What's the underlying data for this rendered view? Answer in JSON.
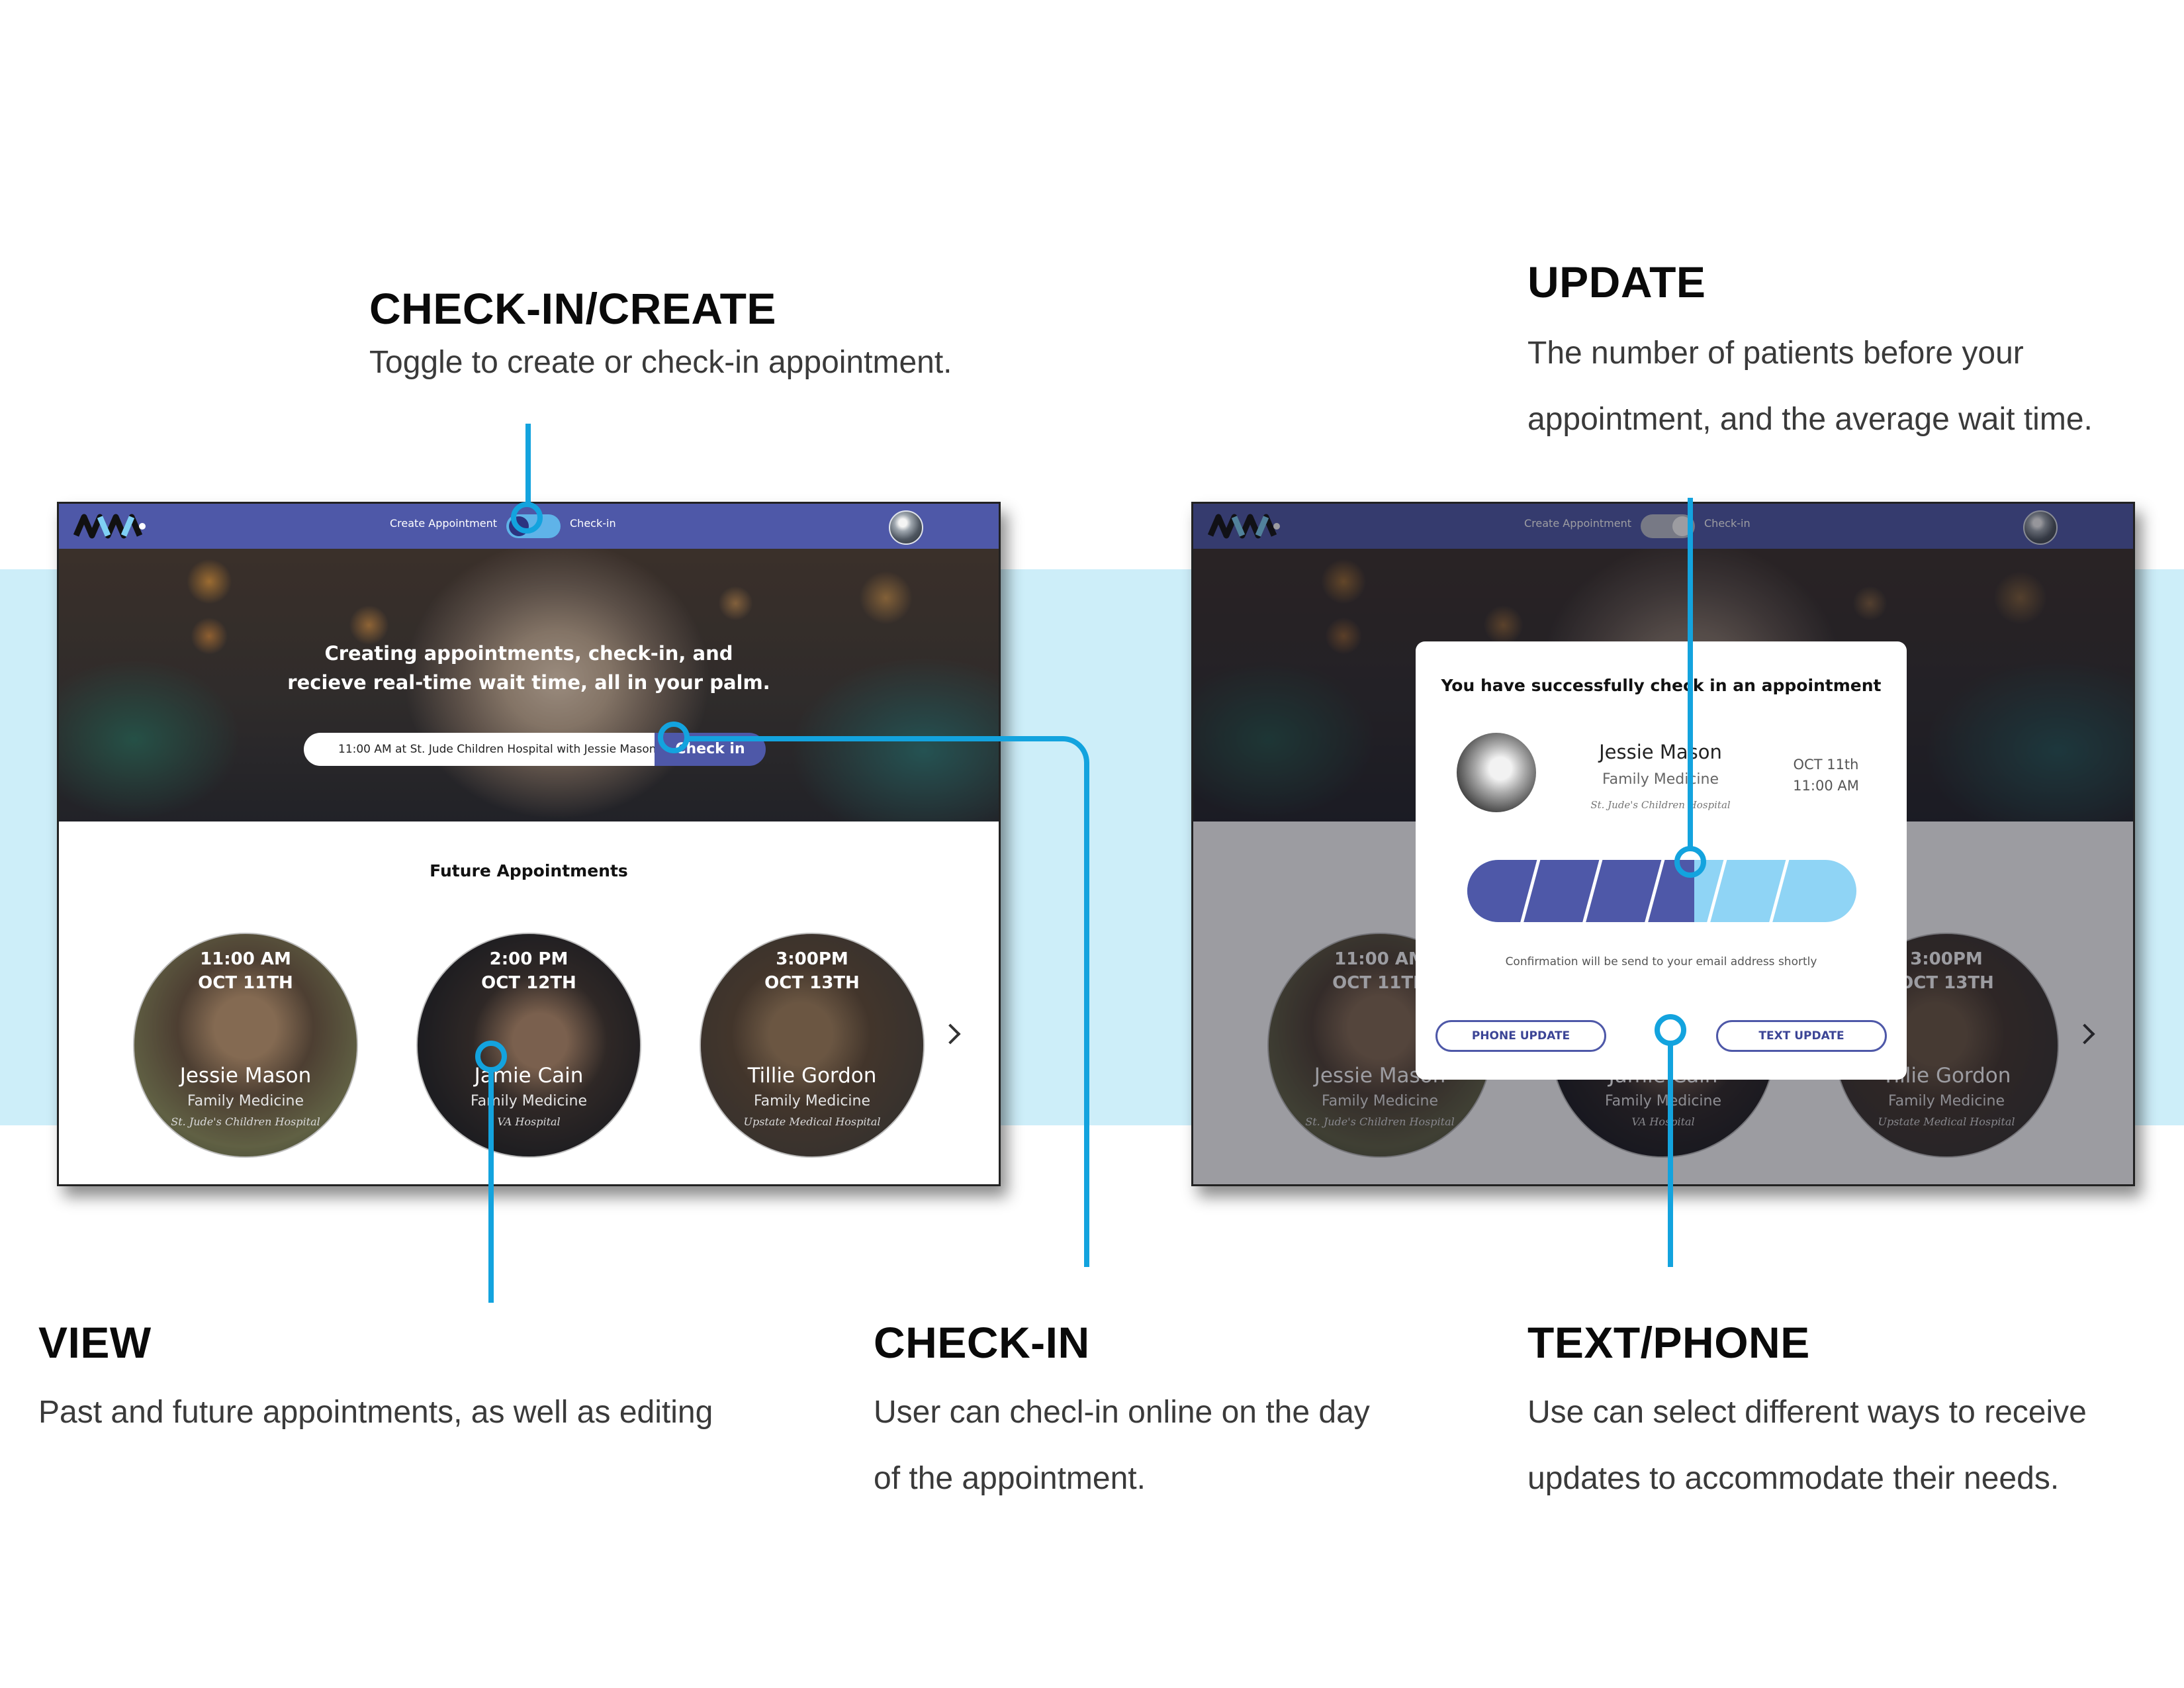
{
  "annotations": {
    "checkin_create": {
      "title": "CHECK-IN/CREATE",
      "desc": "Toggle to create or check-in appointment."
    },
    "update": {
      "title": "UPDATE",
      "desc_line1": "The number of patients before your",
      "desc_line2": "appointment, and the average wait time."
    },
    "view": {
      "title": "VIEW",
      "desc": "Past and future appointments, as well as editing"
    },
    "checkin": {
      "title": "CHECK-IN",
      "desc_line1": "User can checl-in online on the day",
      "desc_line2": "of the appointment."
    },
    "text_phone": {
      "title": "TEXT/PHONE",
      "desc_line1": "Use can select different ways to receive",
      "desc_line2": "updates to accommodate their needs."
    }
  },
  "nav": {
    "create_label": "Create Appointment",
    "checkin_label": "Check-in",
    "logo_icon": "wave-logo-icon",
    "avatar_icon": "user-avatar-icon"
  },
  "hero": {
    "line1": "Creating appointments, check-in, and",
    "line2": "recieve real-time wait time, all in your palm.",
    "search_value": "11:00 AM at St. Jude Children Hospital with Jessie Mason",
    "checkin_button": "Check in"
  },
  "future": {
    "title": "Future Appointments",
    "items": [
      {
        "time": "11:00 AM",
        "date": "OCT 11TH",
        "name": "Jessie Mason",
        "specialty": "Family Medicine",
        "hospital": "St. Jude's Children Hospital"
      },
      {
        "time": "2:00 PM",
        "date": "OCT 12TH",
        "name": "Jamie Cain",
        "specialty": "Family Medicine",
        "hospital": "VA Hospital"
      },
      {
        "time": "3:00PM",
        "date": "OCT 13TH",
        "name": "Tillie Gordon",
        "specialty": "Family Medicine",
        "hospital": "Upstate Medical Hospital"
      }
    ],
    "next_icon": "chevron-right-icon"
  },
  "modal": {
    "title": "You have successfully check in an appointment",
    "name": "Jessie Mason",
    "specialty": "Family Medicine",
    "hospital": "St. Jude's Children Hospital",
    "date": "OCT 11th",
    "time": "11:00 AM",
    "progress_segments_total": 6,
    "progress_segments_filled": 3.5,
    "note": "Confirmation will be send to your email address shortly",
    "phone_button": "PHONE UPDATE",
    "text_button": "TEXT UPDATE"
  },
  "colors": {
    "brand": "#4e58a8",
    "accent": "#13a3de",
    "progress_empty": "#8fd4f5",
    "band": "#cdeef9"
  }
}
